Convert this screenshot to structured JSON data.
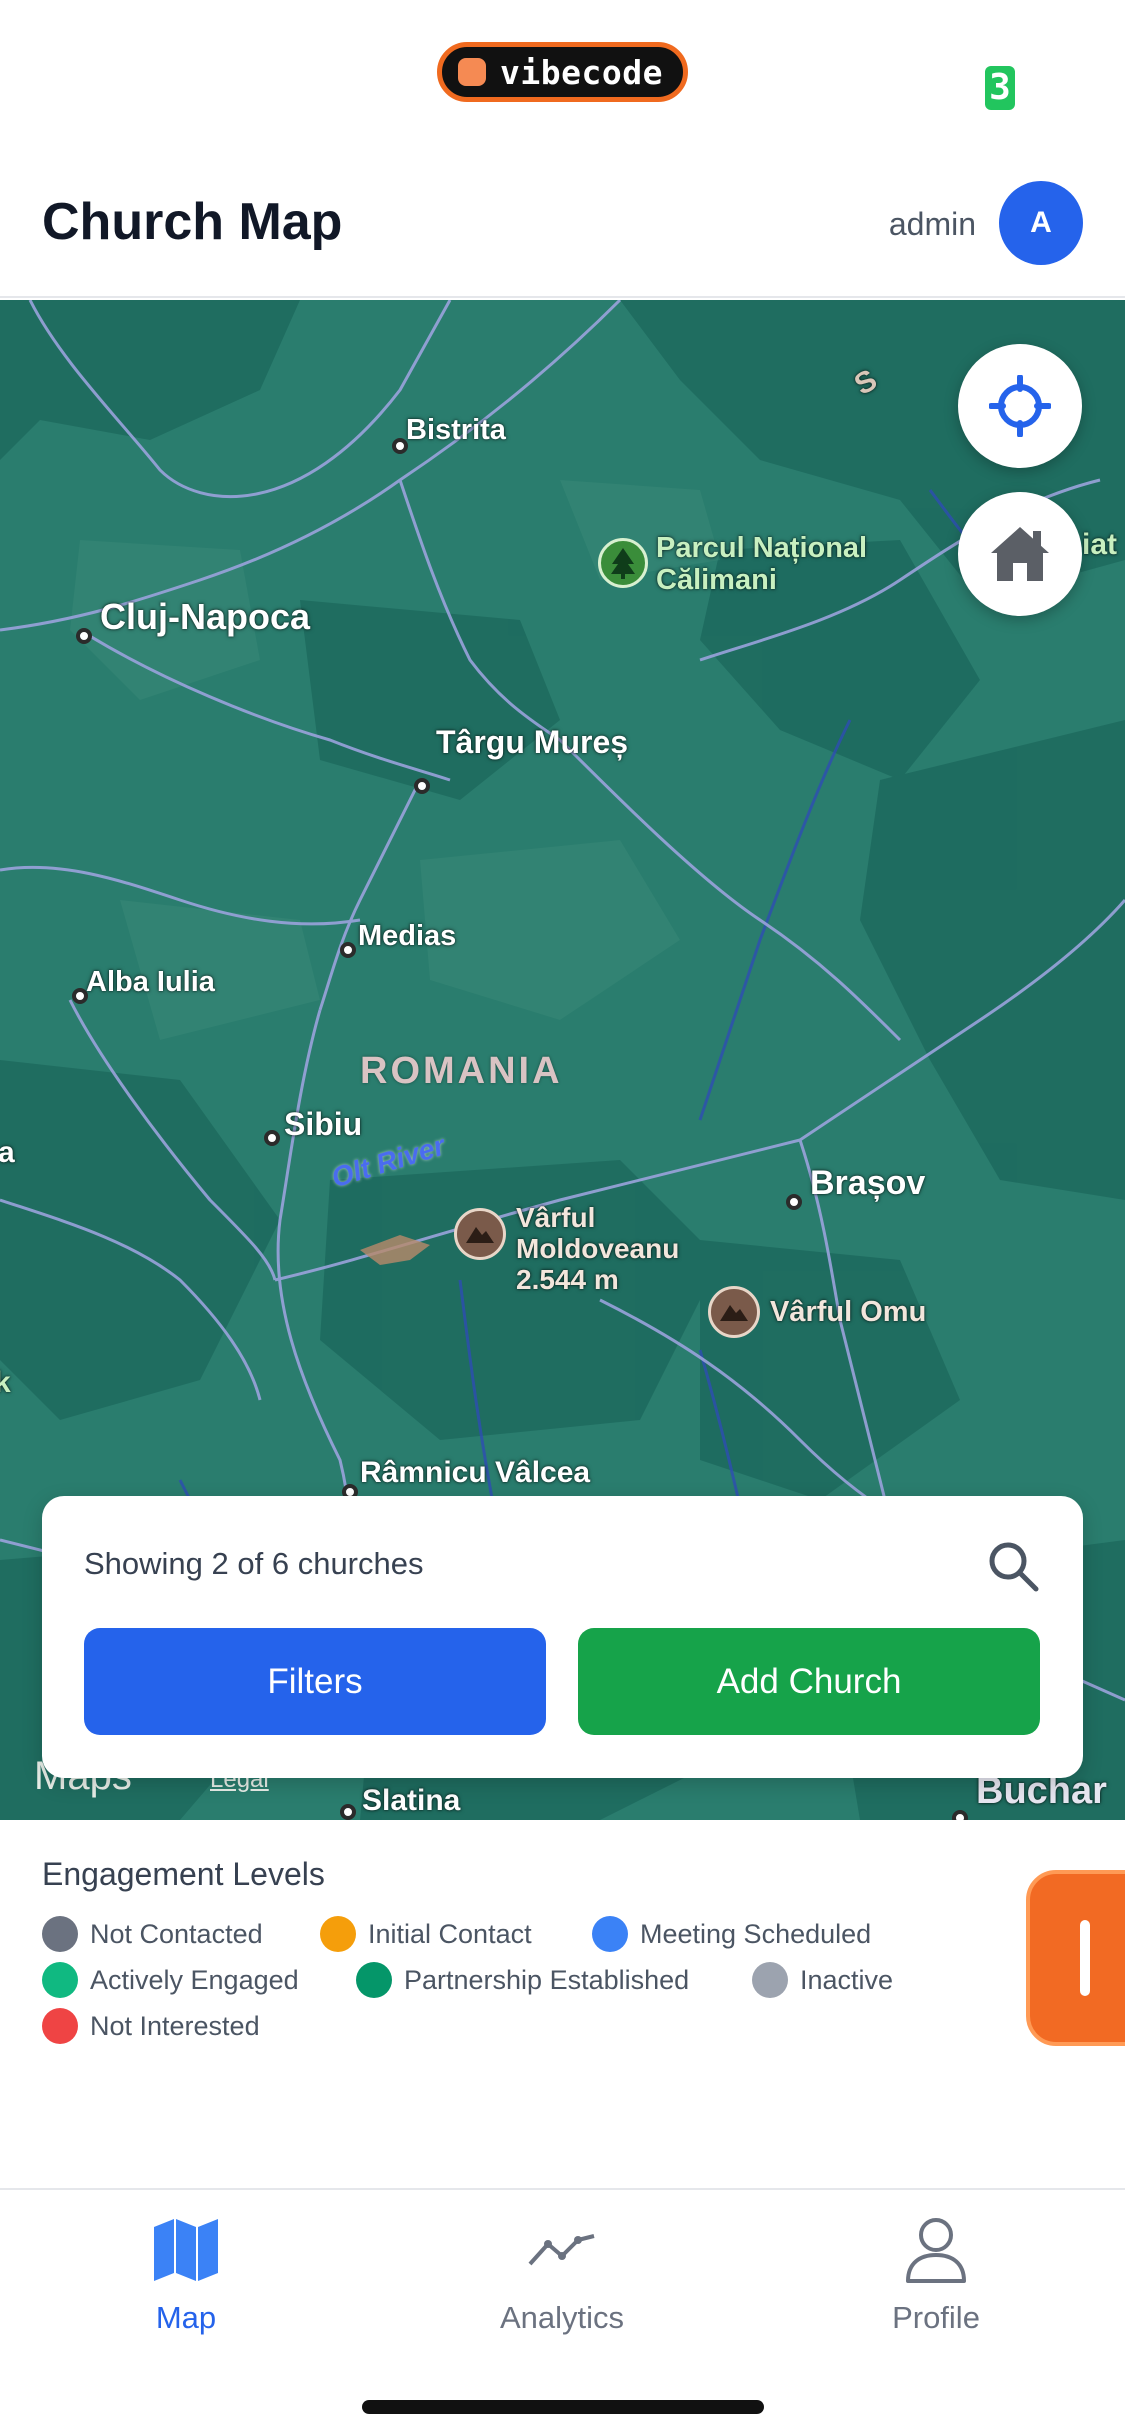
{
  "status_bar": {
    "badge_text": "vibecode",
    "battery_text": "3"
  },
  "header": {
    "title": "Church Map",
    "user_name": "admin",
    "avatar_initial": "A"
  },
  "map": {
    "labels": {
      "bistrita": "Bistrita",
      "parc_line1": "Parcul Național",
      "parc_line2": "Călimani",
      "cluj": "Cluj-Napoca",
      "targu_mures": "Târgu Mureș",
      "medias": "Medias",
      "alba_iulia": "Alba Iulia",
      "romania": "ROMANIA",
      "sibiu": "Sibiu",
      "olt_river": "Olt River",
      "brasov": "Brașov",
      "moldoveanu_line1": "Vârful",
      "moldoveanu_line2": "Moldoveanu",
      "moldoveanu_line3": "2.544 m",
      "omu": "Vârful Omu",
      "ramnicu": "Râmnicu Vâlcea",
      "slatina": "Slatina",
      "buchar": "Buchar",
      "maps": "Maps",
      "legal": "Legal",
      "edge_a": "a",
      "edge_k": "k",
      "edge_iat": "iat",
      "edge_s": "S"
    },
    "colors": {
      "land": "#2a7d6e",
      "roads": "#8f9bd6",
      "forest": "#1f6d61"
    }
  },
  "filter_card": {
    "showing_text": "Showing 2 of 6 churches",
    "filters_label": "Filters",
    "add_church_label": "Add Church",
    "search_icon": "search-icon"
  },
  "legend": {
    "title": "Engagement Levels",
    "items": [
      {
        "label": "Not Contacted",
        "color": "#6b7280"
      },
      {
        "label": "Initial Contact",
        "color": "#f59e0b"
      },
      {
        "label": "Meeting Scheduled",
        "color": "#3b82f6"
      },
      {
        "label": "Actively Engaged",
        "color": "#10b981"
      },
      {
        "label": "Partnership Established",
        "color": "#059669"
      },
      {
        "label": "Inactive",
        "color": "#9ca3af"
      },
      {
        "label": "Not Interested",
        "color": "#ef4444"
      }
    ]
  },
  "bottom_nav": {
    "items": [
      {
        "label": "Map",
        "icon": "map-icon",
        "active": true
      },
      {
        "label": "Analytics",
        "icon": "analytics-icon",
        "active": false
      },
      {
        "label": "Profile",
        "icon": "profile-icon",
        "active": false
      }
    ]
  }
}
